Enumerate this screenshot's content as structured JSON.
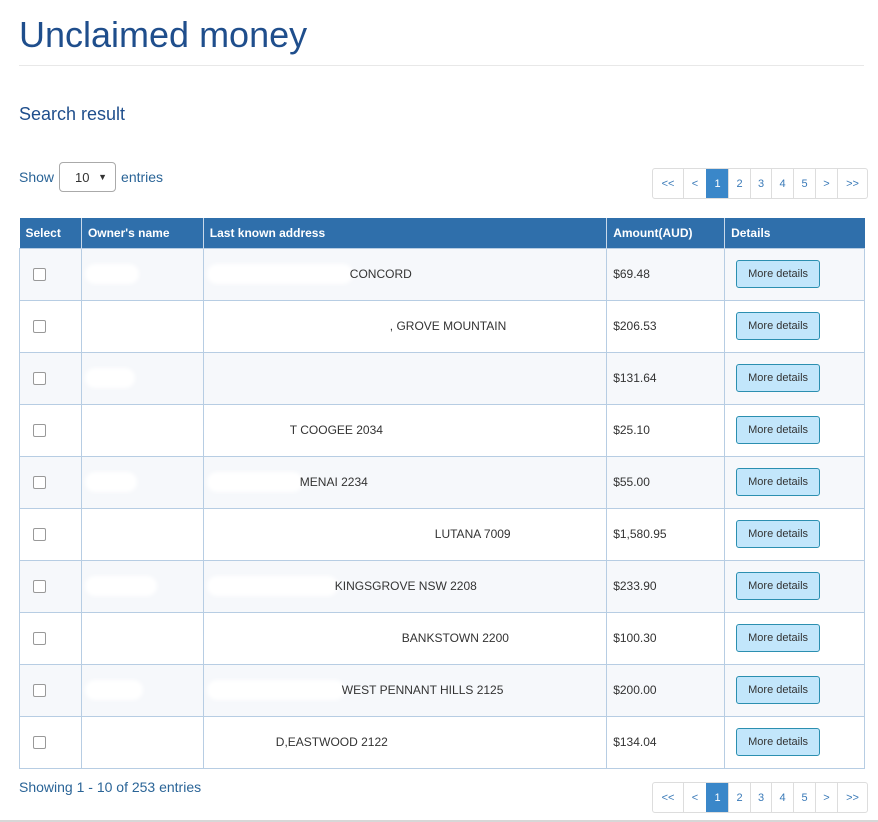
{
  "page": {
    "title": "Unclaimed money",
    "subtitle": "Search result"
  },
  "entries_control": {
    "prefix": "Show",
    "selected": "10",
    "suffix": "entries"
  },
  "pagination": {
    "first": "<<",
    "prev": "<",
    "pages": [
      "1",
      "2",
      "3",
      "4",
      "5"
    ],
    "active_page": "1",
    "next": ">",
    "last": ">>"
  },
  "table": {
    "headers": [
      "Select",
      "Owner's name",
      "Last known address",
      "Amount(AUD)",
      "Details"
    ],
    "rows": [
      {
        "address": "CONCORD",
        "amount": "$69.48",
        "details": "More details"
      },
      {
        "address": ", GROVE MOUNTAIN",
        "amount": "$206.53",
        "details": "More details"
      },
      {
        "address": "",
        "amount": "$131.64",
        "details": "More details"
      },
      {
        "address": "T COOGEE 2034",
        "amount": "$25.10",
        "details": "More details"
      },
      {
        "address": "MENAI 2234",
        "amount": "$55.00",
        "details": "More details"
      },
      {
        "address": "LUTANA 7009",
        "amount": "$1,580.95",
        "details": "More details"
      },
      {
        "address": "KINGSGROVE NSW 2208",
        "amount": "$233.90",
        "details": "More details"
      },
      {
        "address": "BANKSTOWN 2200",
        "amount": "$100.30",
        "details": "More details"
      },
      {
        "address": "WEST PENNANT HILLS 2125",
        "amount": "$200.00",
        "details": "More details"
      },
      {
        "address": "D,EASTWOOD 2122",
        "amount": "$134.04",
        "details": "More details"
      }
    ]
  },
  "footer": {
    "showing": "Showing 1 - 10 of 253 entries"
  },
  "colors": {
    "title": "#1f4e8c",
    "header_bg": "#2f6fab",
    "active_page": "#3a87c9",
    "button_bg": "#c2e6fb"
  },
  "icons": {
    "dropdown": "caret-down-icon",
    "checkbox": "checkbox"
  }
}
